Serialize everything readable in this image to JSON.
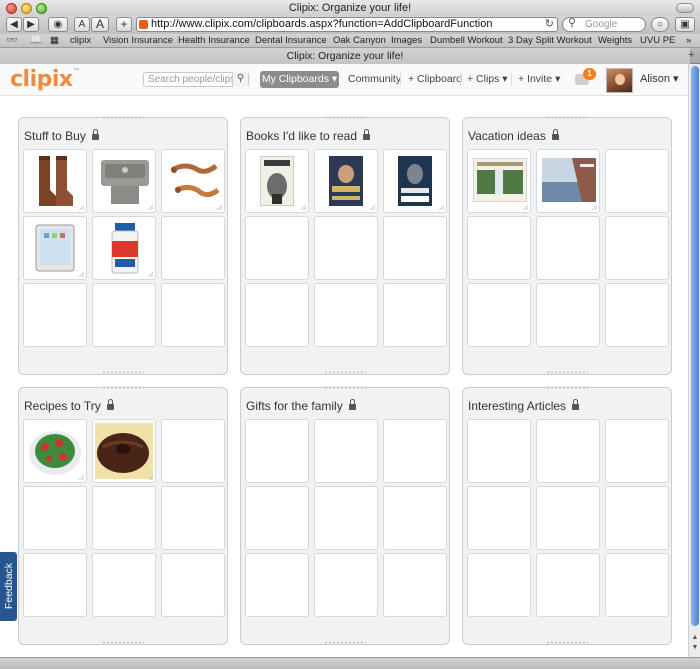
{
  "window": {
    "title": "Clipix: Organize your life!"
  },
  "browser": {
    "url": "http://www.clipix.com/clipboards.aspx?function=AddClipboardFunction",
    "search_placeholder": "Google",
    "font_smaller": "A",
    "font_larger": "A",
    "add_button": "+",
    "bookmarks": [
      "clipix",
      "Vision Insurance",
      "Health Insurance",
      "Dental Insurance",
      "Oak Canyon",
      "Images",
      "Dumbell Workout",
      "3 Day Split Workout",
      "Weights",
      "UVU PE"
    ],
    "tab_title": "Clipix: Organize your life!"
  },
  "header": {
    "logo": "clipix",
    "search_placeholder": "Search people/clips",
    "my_clipboards": "My Clipboards ▾",
    "community": "Community",
    "add_clipboard": "+ Clipboard",
    "add_clips": "+ Clips ▾",
    "invite": "+ Invite ▾",
    "notification_count": "1",
    "username": "Alison ▾"
  },
  "boards": [
    {
      "title": "Stuff to Buy",
      "private": true,
      "clips": [
        "brown-boots",
        "drinking-fountain",
        "toy-lizards",
        "ipad",
        "supplement-bottle"
      ]
    },
    {
      "title": "Books I'd like to read",
      "private": true,
      "clips": [
        "book-the-road-to-serfdom",
        "book-george-washingtons-secret-six",
        "book-killing-lincoln"
      ]
    },
    {
      "title": "Vacation ideas",
      "private": true,
      "clips": [
        "waterfall-travel-article",
        "cruise-ship-deck"
      ]
    },
    {
      "title": "Recipes to Try",
      "private": true,
      "clips": [
        "strawberry-salad",
        "chocolate-bundt-cake"
      ]
    },
    {
      "title": "Gifts for the family",
      "private": true,
      "clips": []
    },
    {
      "title": "Interesting Articles",
      "private": true,
      "clips": []
    }
  ],
  "feedback": {
    "label": "Feedback"
  },
  "colors": {
    "accent": "#f08b3c",
    "feedback": "#27558f",
    "notification": "#f4801f"
  }
}
